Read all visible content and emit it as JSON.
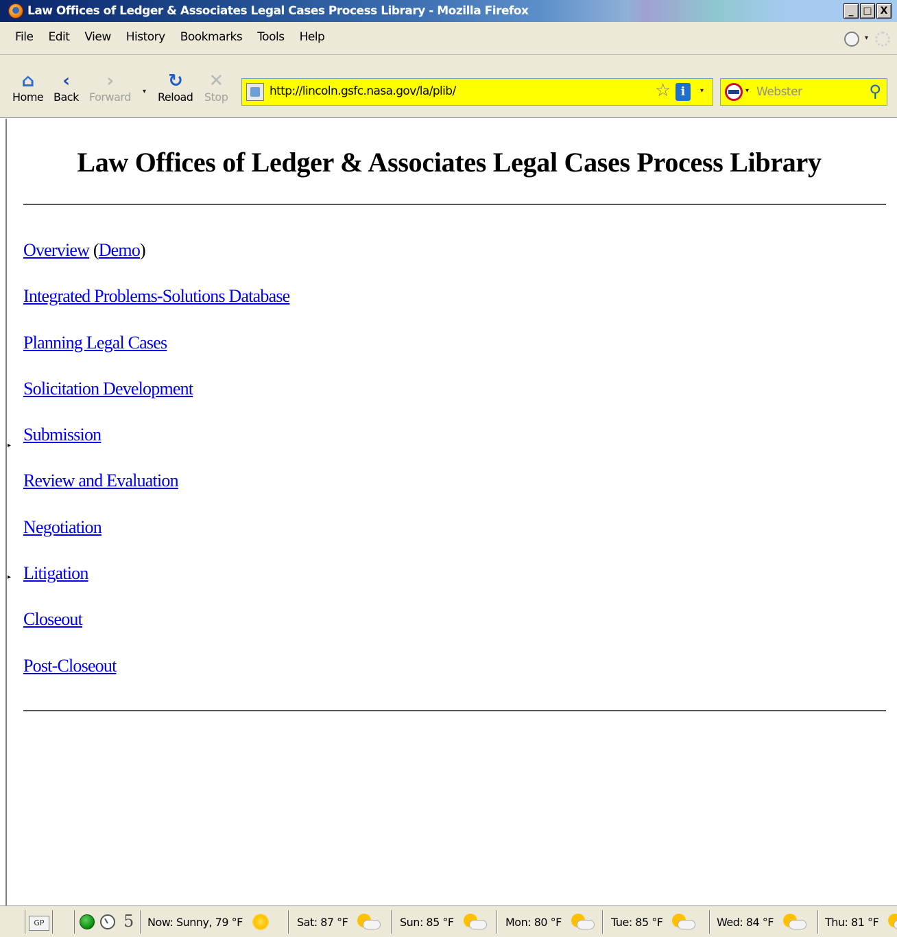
{
  "window": {
    "title": "Law Offices of Ledger & Associates Legal Cases Process Library - Mozilla Firefox",
    "controls": {
      "minimize": "_",
      "maximize": "□",
      "close": "X"
    }
  },
  "menu": {
    "items": [
      {
        "label": "File"
      },
      {
        "label": "Edit"
      },
      {
        "label": "View"
      },
      {
        "label": "History"
      },
      {
        "label": "Bookmarks"
      },
      {
        "label": "Tools"
      },
      {
        "label": "Help"
      }
    ]
  },
  "toolbar": {
    "home": {
      "label": "Home",
      "icon": "home-icon"
    },
    "back": {
      "label": "Back",
      "icon": "back-arrow-icon"
    },
    "forward": {
      "label": "Forward",
      "icon": "forward-arrow-icon"
    },
    "reload": {
      "label": "Reload",
      "icon": "reload-icon"
    },
    "stop": {
      "label": "Stop",
      "icon": "stop-icon"
    },
    "url": "http://lincoln.gsfc.nasa.gov/la/plib/",
    "search_placeholder": "Webster",
    "address_bar_color": "#ffff00"
  },
  "page": {
    "title": "Law Offices of Ledger & Associates Legal Cases Process Library",
    "links": [
      {
        "label": "Overview"
      },
      {
        "label": "Demo"
      },
      {
        "label": "Integrated Problems-Solutions Database"
      },
      {
        "label": "Planning Legal Cases"
      },
      {
        "label": "Solicitation Development"
      },
      {
        "label": "Submission"
      },
      {
        "label": "Review and Evaluation"
      },
      {
        "label": "Negotiation"
      },
      {
        "label": "Litigation"
      },
      {
        "label": "Closeout"
      },
      {
        "label": "Post-Closeout"
      }
    ],
    "paren_open": "(",
    "paren_close": ")",
    "link_color": "#0000ee"
  },
  "statusbar": {
    "gp": "GP",
    "count": "5",
    "now": "Now: Sunny, 79 °F",
    "forecast": [
      {
        "label": "Sat: 87 °F"
      },
      {
        "label": "Sun: 85 °F"
      },
      {
        "label": "Mon: 80 °F"
      },
      {
        "label": "Tue: 85 °F"
      },
      {
        "label": "Wed: 84 °F"
      },
      {
        "label": "Thu: 81 °F"
      }
    ]
  }
}
